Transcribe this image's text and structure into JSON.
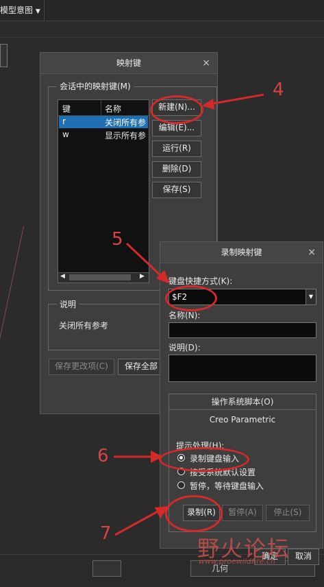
{
  "toolbar": {
    "model_view_label": "模型意图",
    "dropdown_arrow": "chevron-down-icon"
  },
  "mapkey_dialog": {
    "title": "映射键",
    "close": "×",
    "group_label": "会话中的映射键(M)",
    "columns": [
      "键",
      "名称"
    ],
    "rows": [
      {
        "key": "r",
        "name": "关闭所有参"
      },
      {
        "key": "w",
        "name": "显示所有参"
      }
    ],
    "buttons": {
      "new": "新建(N)...",
      "edit": "编辑(E)...",
      "run": "运行(R)",
      "delete": "删除(D)",
      "save": "保存(S)"
    },
    "description_label": "说明",
    "description_text": "关闭所有参考",
    "save_changes": "保存更改项(C)",
    "save_all": "保存全部"
  },
  "record_dialog": {
    "title": "录制映射键",
    "close": "×",
    "shortcut_label": "键盘快捷方式(K):",
    "shortcut_value": "$F2",
    "name_label": "名称(N):",
    "name_value": "",
    "desc_label": "说明(D):",
    "desc_value": "",
    "tab_label": "操作系统脚本(O)",
    "app_name": "Creo Parametric",
    "prompt_label": "提示处理(H):",
    "options": [
      {
        "label": "录制键盘输入",
        "selected": true
      },
      {
        "label": "接受系统默认设置",
        "selected": false
      },
      {
        "label": "暂停，等待键盘输入",
        "selected": false
      }
    ],
    "record": "录制(R)",
    "pause": "暂停(A)",
    "stop": "停止(S)",
    "ok": "确定",
    "cancel": "取消"
  },
  "annotations": {
    "a4": "4",
    "a5": "5",
    "a6": "6",
    "a7": "7"
  },
  "watermark": {
    "main": "野火论坛",
    "url": "www.proewildfire.cn"
  },
  "statusbar": {
    "right_label": "几何"
  },
  "colors": {
    "selection": "#1f6fb3",
    "annotation": "#d42a2a"
  }
}
